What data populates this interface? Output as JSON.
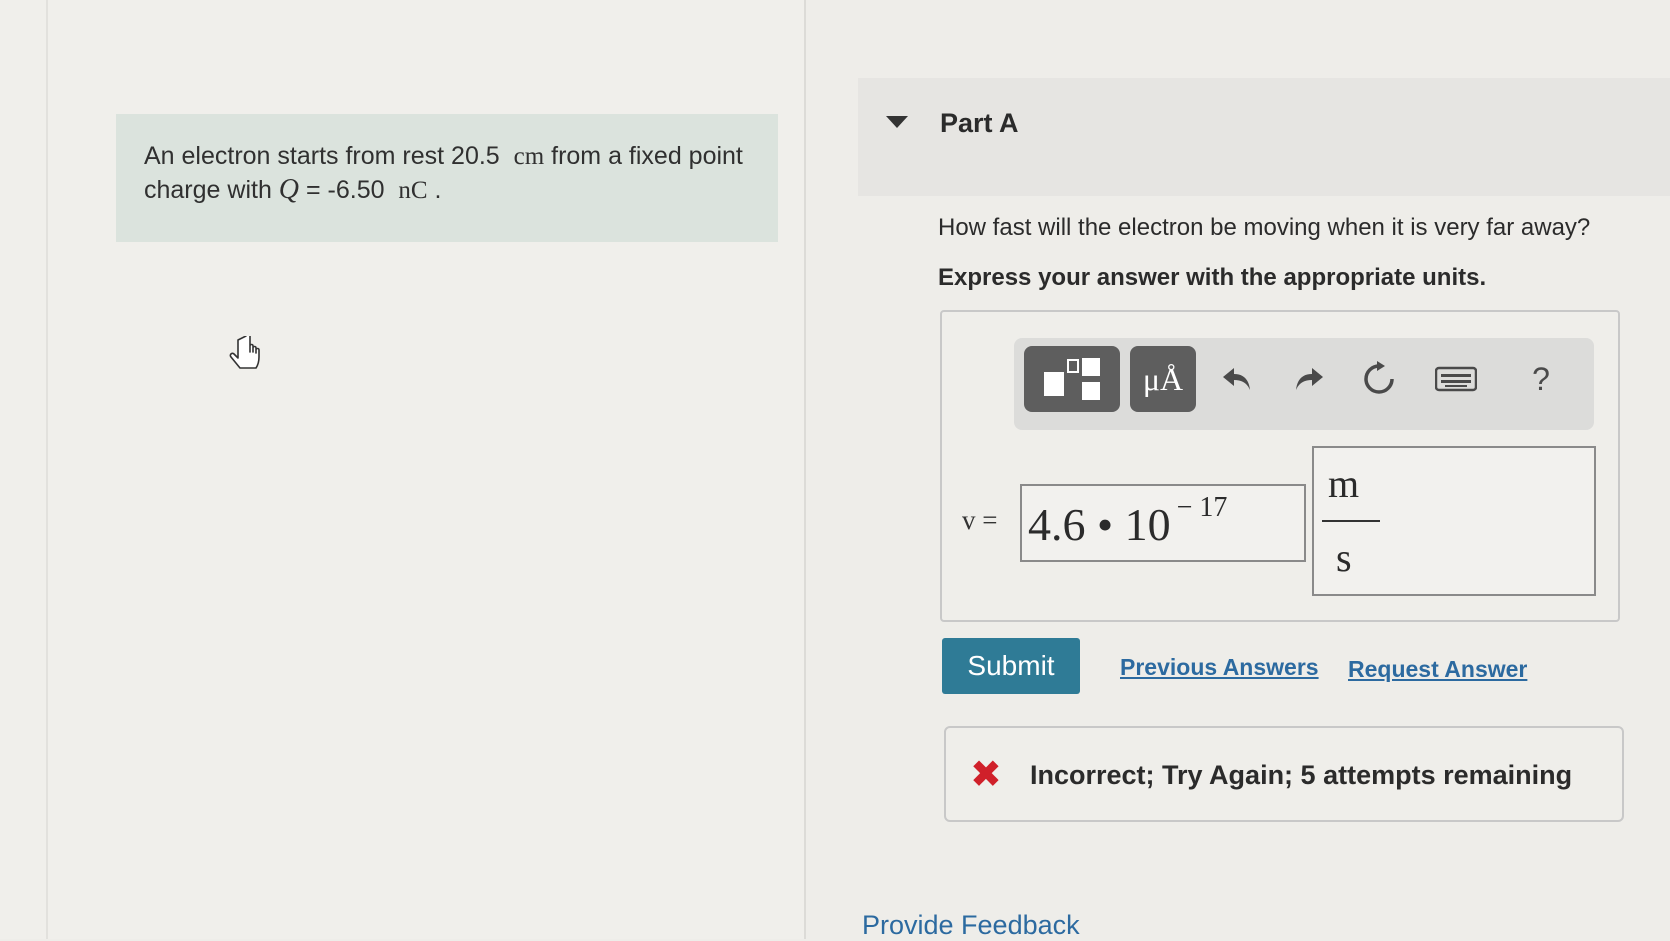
{
  "problem": {
    "text_before_distance": "An electron starts from rest ",
    "distance_value": "20.5",
    "distance_unit": "cm",
    "text_after_distance": " from a fixed point charge with ",
    "charge_symbol": "Q",
    "equals": " = ",
    "charge_value": "-6.50",
    "charge_unit": "nC",
    "period": " ."
  },
  "part": {
    "title": "Part A",
    "question": "How fast will the electron be moving when it is very far away?",
    "instruction": "Express your answer with the appropriate units."
  },
  "toolbar": {
    "units_button": "μÅ",
    "help": "?"
  },
  "answer": {
    "variable": "v =",
    "mantissa": "4.6 • 10",
    "exponent": "− 17",
    "unit_numerator": "m",
    "unit_denominator": "s"
  },
  "actions": {
    "submit": "Submit",
    "previous_answers": "Previous Answers",
    "request_answer": "Request Answer"
  },
  "feedback": {
    "icon": "x-icon",
    "message": "Incorrect; Try Again; 5 attempts remaining"
  },
  "footer": {
    "provide_feedback": "Provide Feedback"
  },
  "colors": {
    "submit_bg": "#2f7b96",
    "link": "#2c6aa0",
    "error": "#d0202a",
    "problem_bg": "#dbe3dd"
  }
}
